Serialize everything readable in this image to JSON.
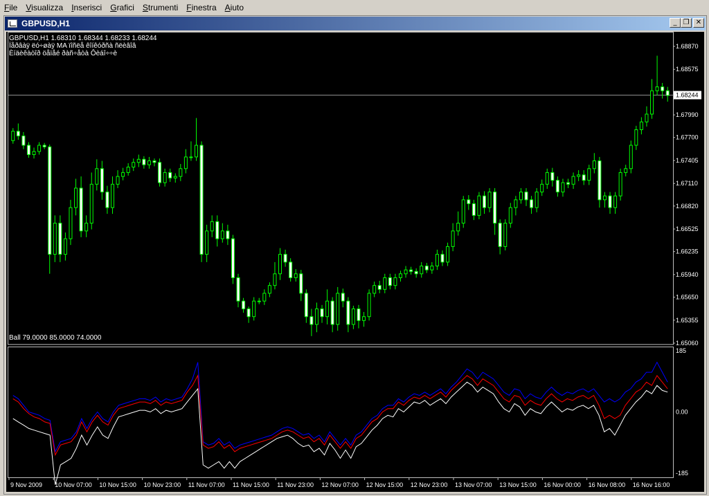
{
  "menu": [
    "File",
    "Visualizza",
    "Inserisci",
    "Grafici",
    "Strumenti",
    "Finestra",
    "Aiuto"
  ],
  "window": {
    "title": "GBPUSD,H1",
    "buttons": {
      "minimize": "_",
      "restore": "❐",
      "close": "✕"
    }
  },
  "main_chart": {
    "header": "GBPUSD,H1  1.68310 1.68344 1.68233 1.68244",
    "line2": "Ïåðâàÿ ëó÷øàÿ MA ïîñëå êîíêóðñà ñëèâîâ",
    "line3": "Èíäèêàòîð öåïåé ðàñ÷åòà Ôèáî÷÷è",
    "current_price_label": "1.68244",
    "colors": {
      "bull": "#00ff00",
      "bear": "#00ff00",
      "body_bull": "#000000",
      "body_bear": "#ffffff"
    }
  },
  "indicator": {
    "header": "Ball 79.0000 85.0000 74.0000",
    "ticks": [
      "185",
      "0.00",
      "-185"
    ],
    "colors": {
      "blue": "#0000ff",
      "red": "#ff0000",
      "white": "#ffffff"
    }
  },
  "price_axis": [
    "1.68870",
    "1.68575",
    "1.68244",
    "1.67990",
    "1.67700",
    "1.67405",
    "1.67110",
    "1.66820",
    "1.66525",
    "1.66235",
    "1.65940",
    "1.65650",
    "1.65355",
    "1.65060"
  ],
  "time_axis": [
    "9 Nov 2009",
    "10 Nov 07:00",
    "10 Nov 15:00",
    "10 Nov 23:00",
    "11 Nov 07:00",
    "11 Nov 15:00",
    "11 Nov 23:00",
    "12 Nov 07:00",
    "12 Nov 15:00",
    "12 Nov 23:00",
    "13 Nov 07:00",
    "13 Nov 15:00",
    "16 Nov 00:00",
    "16 Nov 08:00",
    "16 Nov 16:00"
  ],
  "chart_data": {
    "type": "line",
    "candles": {
      "open": [
        1.6766,
        1.6778,
        1.6772,
        1.676,
        1.6748,
        1.6752,
        1.676,
        1.6758,
        1.662,
        1.666,
        1.662,
        1.664,
        1.668,
        1.6705,
        1.665,
        1.666,
        1.671,
        1.673,
        1.67,
        1.668,
        1.671,
        1.672,
        1.6725,
        1.6732,
        1.6738,
        1.6742,
        1.6735,
        1.674,
        1.6738,
        1.6712,
        1.6725,
        1.6718,
        1.672,
        1.673,
        1.6745,
        1.6745,
        1.676,
        1.662,
        1.665,
        1.6662,
        1.664,
        1.665,
        1.664,
        1.659,
        1.656,
        1.655,
        1.654,
        1.656,
        1.656,
        1.657,
        1.658,
        1.6595,
        1.662,
        1.661,
        1.659,
        1.6595,
        1.657,
        1.654,
        1.653,
        1.655,
        1.654,
        1.656,
        1.653,
        1.657,
        1.656,
        1.653,
        1.655,
        1.6535,
        1.654,
        1.657,
        1.658,
        1.6575,
        1.659,
        1.658,
        1.659,
        1.6595,
        1.66,
        1.6598,
        1.6595,
        1.6605,
        1.66,
        1.6605,
        1.662,
        1.661,
        1.663,
        1.665,
        1.666,
        1.669,
        1.6685,
        1.667,
        1.6695,
        1.668,
        1.67,
        1.666,
        1.663,
        1.666,
        1.668,
        1.669,
        1.67,
        1.669,
        1.668,
        1.67,
        1.671,
        1.6725,
        1.6715,
        1.67,
        1.6712,
        1.671,
        1.672,
        1.6722,
        1.6715,
        1.673,
        1.674,
        1.669,
        1.6695,
        1.668,
        1.6695,
        1.6725,
        1.673,
        1.676,
        1.678,
        1.679,
        1.68,
        1.683,
        1.6835,
        1.683
      ],
      "close": [
        1.6778,
        1.6772,
        1.676,
        1.6748,
        1.6752,
        1.676,
        1.6758,
        1.662,
        1.666,
        1.662,
        1.664,
        1.668,
        1.6705,
        1.665,
        1.666,
        1.671,
        1.673,
        1.67,
        1.668,
        1.671,
        1.672,
        1.6725,
        1.6732,
        1.6738,
        1.6742,
        1.6735,
        1.674,
        1.6738,
        1.6712,
        1.6725,
        1.6718,
        1.672,
        1.673,
        1.6745,
        1.6745,
        1.676,
        1.662,
        1.665,
        1.6662,
        1.664,
        1.665,
        1.664,
        1.659,
        1.656,
        1.655,
        1.654,
        1.656,
        1.656,
        1.657,
        1.658,
        1.6595,
        1.662,
        1.661,
        1.659,
        1.6595,
        1.657,
        1.654,
        1.653,
        1.655,
        1.654,
        1.656,
        1.653,
        1.657,
        1.656,
        1.653,
        1.655,
        1.6535,
        1.654,
        1.657,
        1.658,
        1.6575,
        1.659,
        1.658,
        1.659,
        1.6595,
        1.66,
        1.6598,
        1.6595,
        1.6605,
        1.66,
        1.6605,
        1.662,
        1.661,
        1.663,
        1.665,
        1.666,
        1.669,
        1.6685,
        1.667,
        1.6695,
        1.668,
        1.67,
        1.666,
        1.663,
        1.666,
        1.668,
        1.669,
        1.67,
        1.669,
        1.668,
        1.67,
        1.671,
        1.6725,
        1.6715,
        1.67,
        1.6712,
        1.671,
        1.672,
        1.6722,
        1.6715,
        1.673,
        1.674,
        1.669,
        1.6695,
        1.668,
        1.6695,
        1.6725,
        1.673,
        1.676,
        1.678,
        1.679,
        1.68,
        1.683,
        1.6835,
        1.683,
        1.6824
      ],
      "high_offset": [
        0.0004,
        0.001,
        0.0005,
        0.0004,
        0.0005,
        0.0004,
        0.0003,
        0.0003,
        0.001,
        0.001,
        0.0008,
        0.001,
        0.0012,
        0.0015,
        0.001,
        0.0015,
        0.0012,
        0.001,
        0.0008,
        0.001,
        0.0008,
        0.0006,
        0.0005,
        0.0005,
        0.0006,
        0.0004,
        0.0005,
        0.0003,
        0.0005,
        0.0005,
        0.0005,
        0.0004,
        0.0006,
        0.001,
        0.002,
        0.0035,
        0.0005,
        0.0008,
        0.0008,
        0.0008,
        0.001,
        0.0008,
        0.0005,
        0.0005,
        0.0004,
        0.0003,
        0.0005,
        0.0004,
        0.0005,
        0.0004,
        0.0015,
        0.0008,
        0.0006,
        0.0005,
        0.0006,
        0.0005,
        0.0005,
        0.001,
        0.0008,
        0.0005,
        0.0015,
        0.0005,
        0.0008,
        0.0006,
        0.0005,
        0.0004,
        0.0005,
        0.0006,
        0.0005,
        0.0005,
        0.0006,
        0.0005,
        0.0005,
        0.0005,
        0.0004,
        0.0005,
        0.0004,
        0.0004,
        0.0005,
        0.0004,
        0.0005,
        0.0006,
        0.0005,
        0.0005,
        0.001,
        0.0015,
        0.0005,
        0.0006,
        0.0005,
        0.0005,
        0.0006,
        0.0005,
        0.0005,
        0.0005,
        0.0005,
        0.0006,
        0.0005,
        0.0005,
        0.0005,
        0.0005,
        0.0005,
        0.0006,
        0.0005,
        0.0006,
        0.0005,
        0.0005,
        0.0005,
        0.0005,
        0.0006,
        0.0006,
        0.0005,
        0.001,
        0.0005,
        0.0005,
        0.0005,
        0.0005,
        0.0005,
        0.0005,
        0.0006,
        0.0005,
        0.0006,
        0.001,
        0.0015,
        0.004,
        0.0005,
        0.0005
      ],
      "low_offset": [
        0.0004,
        0.0005,
        0.0005,
        0.0004,
        0.0005,
        0.0004,
        0.0003,
        0.0025,
        0.001,
        0.001,
        0.0008,
        0.0008,
        0.001,
        0.0008,
        0.0008,
        0.0008,
        0.0008,
        0.001,
        0.0008,
        0.0008,
        0.0005,
        0.0005,
        0.0004,
        0.0005,
        0.0006,
        0.0005,
        0.0005,
        0.0005,
        0.0005,
        0.0005,
        0.0005,
        0.0006,
        0.0006,
        0.0006,
        0.0005,
        0.0005,
        0.001,
        0.001,
        0.0008,
        0.001,
        0.0005,
        0.0008,
        0.0008,
        0.0008,
        0.0005,
        0.0008,
        0.0005,
        0.0004,
        0.0005,
        0.0005,
        0.0005,
        0.0008,
        0.0006,
        0.0005,
        0.0005,
        0.001,
        0.0008,
        0.0015,
        0.001,
        0.0008,
        0.001,
        0.001,
        0.0008,
        0.0008,
        0.001,
        0.0006,
        0.001,
        0.0008,
        0.0005,
        0.0005,
        0.0005,
        0.0005,
        0.0005,
        0.0005,
        0.0005,
        0.0005,
        0.0004,
        0.0005,
        0.0005,
        0.0004,
        0.0005,
        0.0005,
        0.0005,
        0.0005,
        0.0006,
        0.0006,
        0.0006,
        0.0008,
        0.0006,
        0.0005,
        0.0008,
        0.0006,
        0.0015,
        0.001,
        0.0005,
        0.0006,
        0.001,
        0.0005,
        0.0008,
        0.0008,
        0.0006,
        0.0005,
        0.0006,
        0.0008,
        0.0006,
        0.0006,
        0.0005,
        0.0006,
        0.0006,
        0.0006,
        0.0006,
        0.0006,
        0.001,
        0.001,
        0.0008,
        0.0008,
        0.0006,
        0.0005,
        0.0006,
        0.0006,
        0.0006,
        0.0006,
        0.0006,
        0.0006,
        0.001,
        0.0008,
        0.001,
        0.0005
      ]
    },
    "price_range": [
      1.6506,
      1.6895
    ],
    "current_price": 1.68244,
    "indicator_range": [
      -185,
      185
    ],
    "blue": [
      50,
      40,
      20,
      0,
      -5,
      -10,
      -20,
      -25,
      -120,
      -90,
      -85,
      -80,
      -60,
      -20,
      -50,
      -20,
      0,
      -20,
      -30,
      0,
      20,
      25,
      30,
      35,
      40,
      40,
      35,
      45,
      30,
      40,
      35,
      40,
      45,
      70,
      100,
      150,
      -90,
      -100,
      -95,
      -80,
      -100,
      -90,
      -110,
      -100,
      -95,
      -90,
      -85,
      -80,
      -75,
      -70,
      -60,
      -50,
      -45,
      -50,
      -60,
      -70,
      -65,
      -80,
      -70,
      -90,
      -60,
      -80,
      -100,
      -80,
      -100,
      -70,
      -60,
      -40,
      -20,
      -10,
      10,
      20,
      20,
      40,
      30,
      45,
      55,
      50,
      60,
      50,
      60,
      70,
      55,
      75,
      90,
      110,
      130,
      120,
      100,
      120,
      110,
      100,
      80,
      60,
      50,
      70,
      65,
      40,
      55,
      45,
      40,
      60,
      75,
      60,
      50,
      60,
      55,
      65,
      70,
      60,
      70,
      50,
      30,
      40,
      30,
      40,
      60,
      70,
      90,
      100,
      120,
      120,
      150,
      120,
      90
    ],
    "red": [
      40,
      30,
      10,
      -5,
      -15,
      -20,
      -30,
      -35,
      -130,
      -100,
      -95,
      -90,
      -70,
      -30,
      -60,
      -30,
      -10,
      -30,
      -40,
      -10,
      10,
      15,
      20,
      25,
      30,
      30,
      25,
      35,
      20,
      30,
      25,
      30,
      35,
      60,
      80,
      110,
      -100,
      -110,
      -105,
      -90,
      -110,
      -100,
      -120,
      -110,
      -105,
      -100,
      -95,
      -90,
      -85,
      -80,
      -70,
      -60,
      -55,
      -60,
      -70,
      -80,
      -75,
      -90,
      -80,
      -100,
      -70,
      -90,
      -110,
      -90,
      -110,
      -80,
      -70,
      -50,
      -30,
      -20,
      0,
      10,
      10,
      30,
      20,
      35,
      45,
      40,
      50,
      40,
      50,
      60,
      45,
      65,
      80,
      95,
      110,
      100,
      80,
      100,
      90,
      80,
      60,
      40,
      30,
      50,
      45,
      20,
      35,
      25,
      20,
      40,
      55,
      40,
      30,
      40,
      35,
      45,
      50,
      40,
      50,
      20,
      -20,
      -10,
      -20,
      -10,
      20,
      40,
      60,
      70,
      90,
      80,
      110,
      90,
      70
    ],
    "white": [
      -20,
      -30,
      -40,
      -50,
      -55,
      -60,
      -65,
      -70,
      -220,
      -160,
      -150,
      -140,
      -110,
      -70,
      -100,
      -70,
      -45,
      -70,
      -80,
      -45,
      -15,
      -10,
      -5,
      0,
      5,
      5,
      0,
      10,
      -5,
      5,
      0,
      5,
      10,
      30,
      50,
      70,
      -160,
      -170,
      -160,
      -150,
      -170,
      -150,
      -170,
      -150,
      -140,
      -130,
      -120,
      -110,
      -100,
      -90,
      -80,
      -75,
      -70,
      -80,
      -95,
      -105,
      -100,
      -120,
      -110,
      -130,
      -95,
      -115,
      -140,
      -115,
      -140,
      -105,
      -95,
      -75,
      -55,
      -40,
      -20,
      -10,
      -15,
      10,
      0,
      15,
      30,
      25,
      35,
      20,
      30,
      40,
      25,
      45,
      60,
      75,
      90,
      80,
      60,
      75,
      65,
      55,
      30,
      10,
      0,
      25,
      15,
      -10,
      10,
      0,
      -5,
      15,
      30,
      15,
      0,
      10,
      5,
      15,
      20,
      10,
      20,
      -10,
      -60,
      -50,
      -70,
      -40,
      -10,
      10,
      30,
      45,
      65,
      55,
      80,
      65,
      60
    ]
  }
}
